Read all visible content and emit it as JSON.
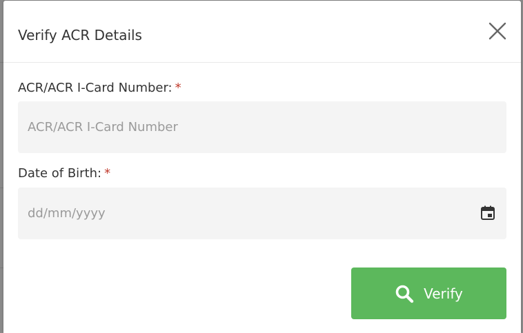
{
  "modal": {
    "title": "Verify ACR Details",
    "close_icon": "close-icon"
  },
  "fields": {
    "acr_number": {
      "label": "ACR/ACR I-Card Number:",
      "required_mark": "*",
      "value": "",
      "placeholder": "ACR/ACR I-Card Number"
    },
    "dob": {
      "label": "Date of Birth:",
      "required_mark": "*",
      "value": "",
      "placeholder": "dd/mm/yyyy",
      "icon": "calendar-icon"
    }
  },
  "actions": {
    "verify_label": "Verify",
    "verify_icon": "search-icon"
  },
  "colors": {
    "primary_button": "#5cb85c",
    "required_mark": "#c0392b",
    "input_background": "#f4f4f4"
  }
}
